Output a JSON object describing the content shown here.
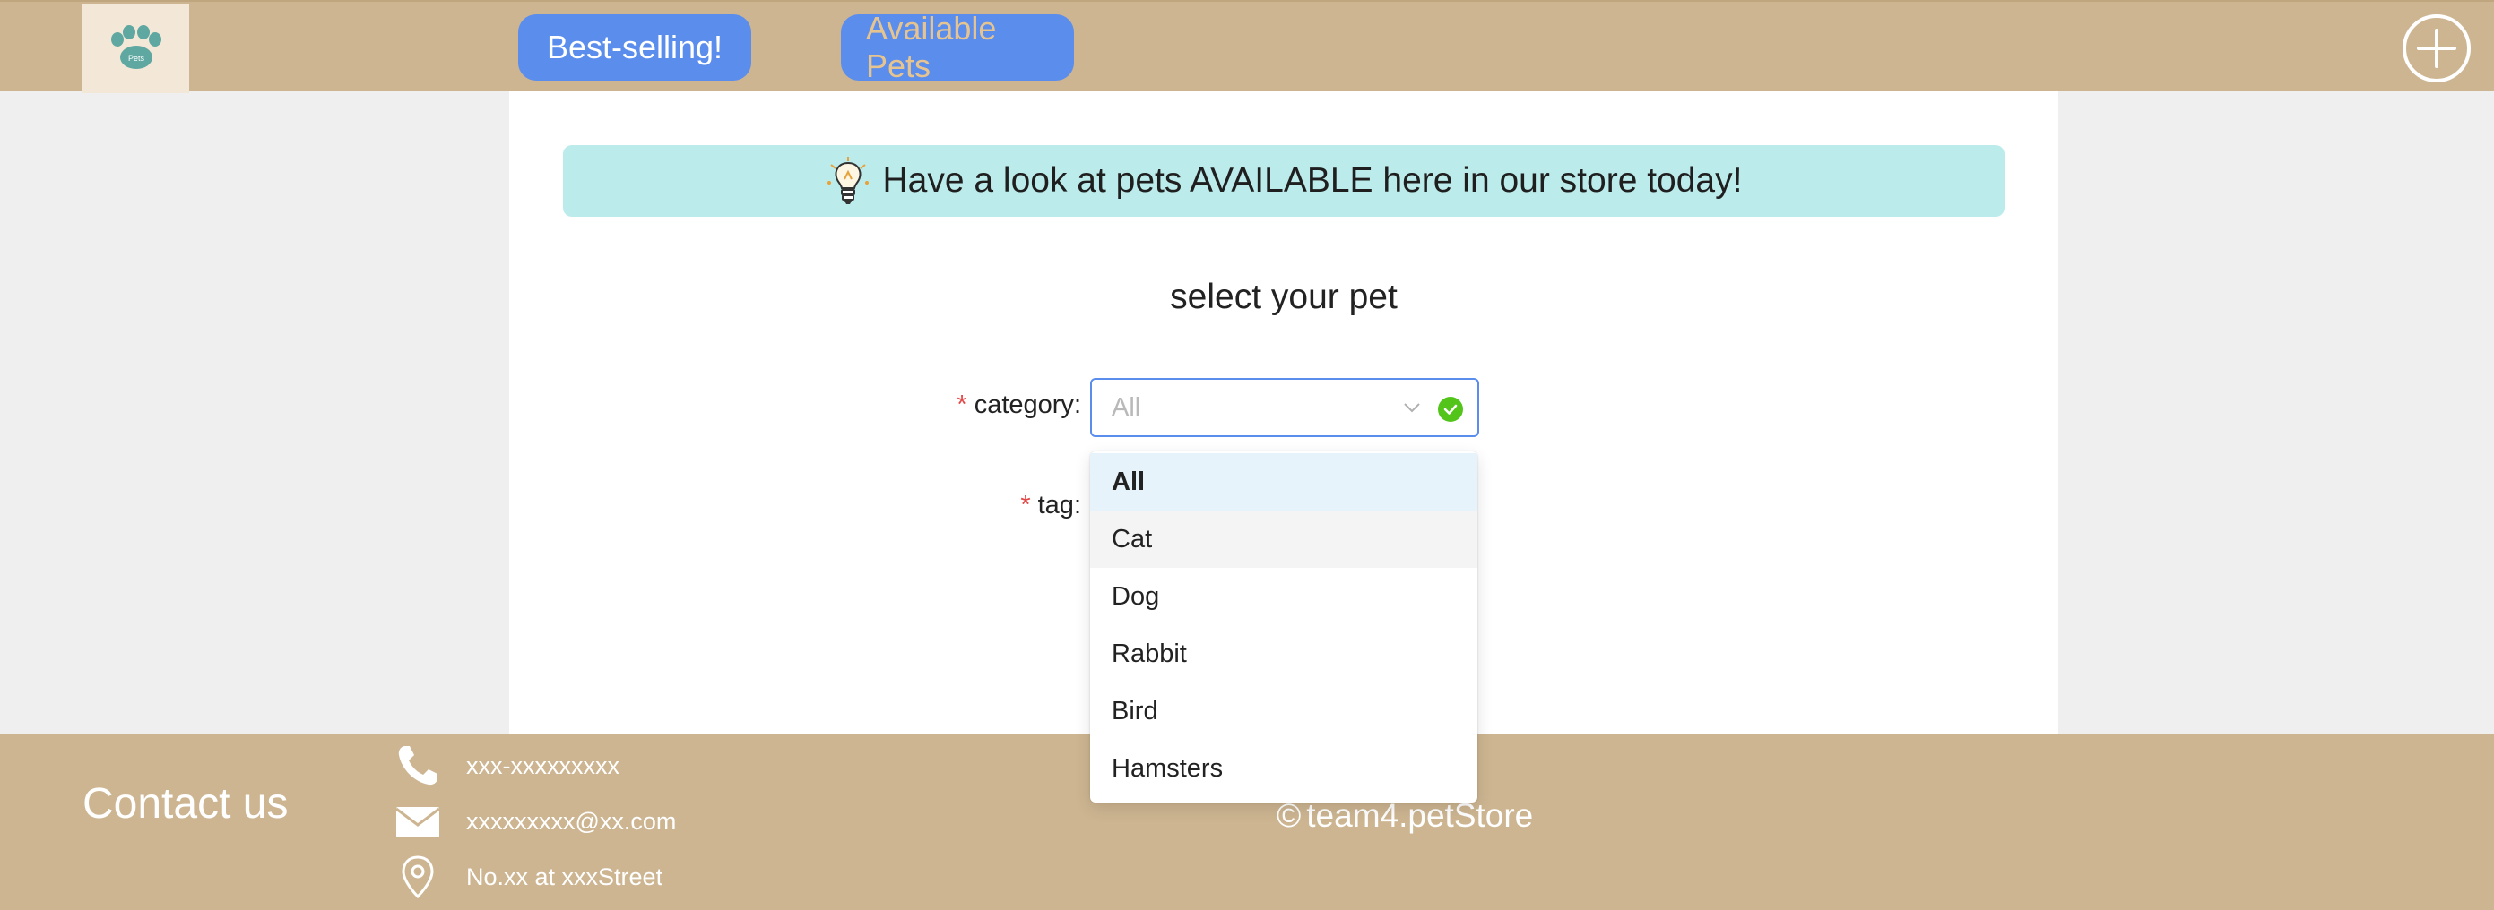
{
  "header": {
    "logo_text": "Pets",
    "nav": {
      "best_selling": "Best-selling!",
      "available_pets": "Available Pets"
    }
  },
  "banner": {
    "text": "Have a look at pets AVAILABLE here in our store today!"
  },
  "form": {
    "title": "select your pet",
    "category_label": "category",
    "tag_label": "tag",
    "required_marker": "*",
    "label_colon": ":",
    "category_value": "All"
  },
  "dropdown": {
    "options": [
      "All",
      "Cat",
      "Dog",
      "Rabbit",
      "Bird",
      "Hamsters"
    ],
    "selected": "All",
    "hovered": "Cat"
  },
  "footer": {
    "contact_title": "Contact us",
    "phone": "xxx-xxxxxxxxx",
    "email": "xxxxxxxxx@xx.com",
    "address": "No.xx at xxxStreet",
    "copyright_symbol": "©",
    "copyright": "team4.petStore"
  },
  "colors": {
    "header_bg": "#cdb591",
    "nav_button": "#5b8ded",
    "banner_bg": "#bcebeb",
    "required": "#e54545",
    "success": "#52c41a"
  }
}
